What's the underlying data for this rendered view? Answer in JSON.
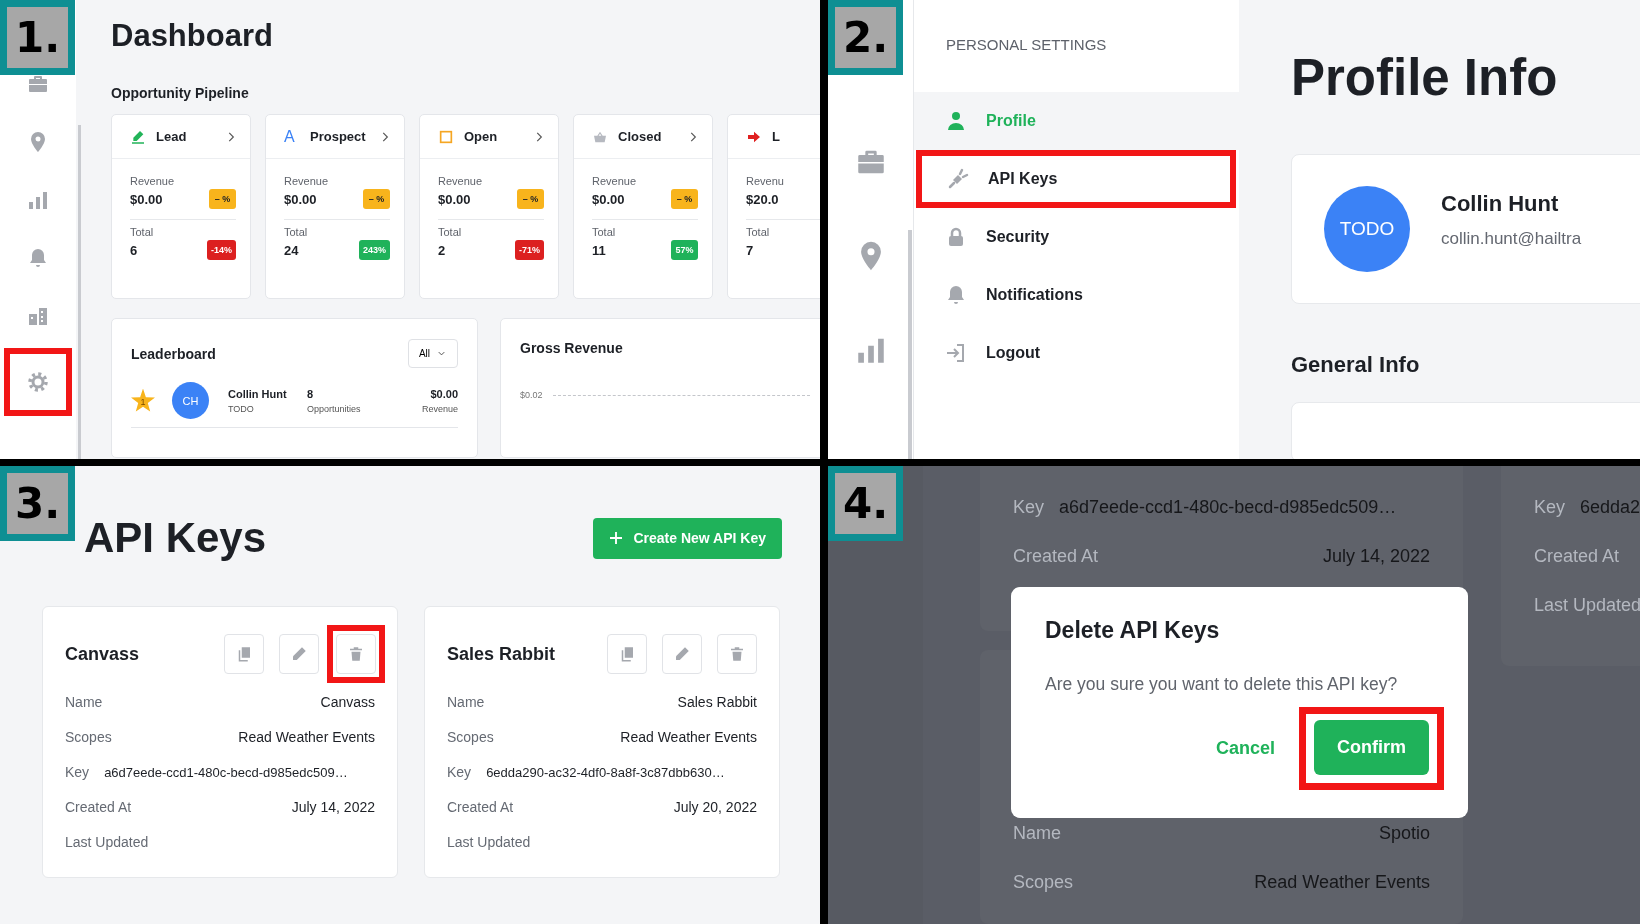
{
  "panels": [
    {
      "kind": "dashboard",
      "step": "1.",
      "nav": [
        {
          "highlighted": false
        },
        {
          "highlighted": false
        },
        {
          "highlighted": false
        },
        {
          "highlighted": false
        },
        {
          "highlighted": false
        },
        {
          "highlighted": true
        }
      ],
      "title": "Dashboard",
      "section": "Opportunity Pipeline",
      "stages": [
        {
          "kind": "pen",
          "label": "Lead",
          "chevron": true,
          "metrics": [
            {
              "label": "Revenue",
              "value": "$0.00",
              "change": "– %",
              "color": "#f8b41c"
            },
            {
              "label": "Total",
              "value": "6",
              "change": "-14%",
              "color": "#dc2020"
            }
          ]
        },
        {
          "kind": "letter",
          "icon_text": "A",
          "label": "Prospect",
          "chevron": true,
          "metrics": [
            {
              "label": "Revenue",
              "value": "$0.00",
              "change": "– %",
              "color": "#f8b41c"
            },
            {
              "label": "Total",
              "value": "24",
              "change": "243%",
              "color": "#1fb25a"
            }
          ]
        },
        {
          "kind": "square",
          "label": "Open",
          "chevron": true,
          "metrics": [
            {
              "label": "Revenue",
              "value": "$0.00",
              "change": "– %",
              "color": "#f8b41c"
            },
            {
              "label": "Total",
              "value": "2",
              "change": "-71%",
              "color": "#dc2020"
            }
          ]
        },
        {
          "kind": "basket",
          "label": "Closed",
          "chevron": true,
          "metrics": [
            {
              "label": "Revenue",
              "value": "$0.00",
              "change": "– %",
              "color": "#f8b41c"
            },
            {
              "label": "Total",
              "value": "11",
              "change": "57%",
              "color": "#1fb25a"
            }
          ]
        },
        {
          "kind": "arrow",
          "label": "L",
          "chevron": false,
          "metrics": [
            {
              "label": "Revenu",
              "value": "$20.0"
            },
            {
              "label": "Total",
              "value": "7"
            }
          ]
        }
      ],
      "leaderboard": {
        "title": "Leaderboard",
        "filter": "All",
        "rows": [
          {
            "rank": "1",
            "initials": "CH",
            "name": "Collin Hunt",
            "subtitle": "TODO",
            "count": "8",
            "count_label": "Opportunities",
            "amount": "$0.00",
            "amount_label": "Revenue"
          }
        ]
      },
      "revenue_chart": {
        "title": "Gross Revenue",
        "axis_label": "$0.02"
      }
    },
    {
      "kind": "settings",
      "step": "2.",
      "heading": "PERSONAL SETTINGS",
      "items": [
        {
          "kind": "person",
          "label": "Profile",
          "selected": true,
          "highlighted": false
        },
        {
          "kind": "plug",
          "label": "API Keys",
          "selected": false,
          "highlighted": true
        },
        {
          "kind": "lock",
          "label": "Security",
          "selected": false,
          "highlighted": false
        },
        {
          "kind": "bell",
          "label": "Notifications",
          "selected": false,
          "highlighted": false
        },
        {
          "kind": "logout",
          "label": "Logout",
          "selected": false,
          "highlighted": false
        }
      ],
      "title": "Profile Info",
      "profile": {
        "avatar": "TODO",
        "name": "Collin Hunt",
        "email": "collin.hunt@hailtra"
      },
      "section": "General Info"
    },
    {
      "kind": "keys",
      "step": "3.",
      "title": "API Keys",
      "create_button": "Create New API Key",
      "keys": [
        {
          "title": "Canvass",
          "delete_highlighted": true,
          "fields": [
            {
              "kind": "pair",
              "label": "Name",
              "value": "Canvass"
            },
            {
              "kind": "pair",
              "label": "Scopes",
              "value": "Read Weather Events"
            },
            {
              "kind": "inline",
              "label": "Key",
              "value": "a6d7eede-ccd1-480c-becd-d985edc509…"
            },
            {
              "kind": "pair",
              "label": "Created At",
              "value": "July 14, 2022"
            },
            {
              "kind": "pair",
              "label": "Last Updated"
            }
          ]
        },
        {
          "title": "Sales Rabbit",
          "delete_highlighted": false,
          "fields": [
            {
              "kind": "pair",
              "label": "Name",
              "value": "Sales Rabbit"
            },
            {
              "kind": "pair",
              "label": "Scopes",
              "value": "Read Weather Events"
            },
            {
              "kind": "inline",
              "label": "Key",
              "value": "6edda290-ac32-4df0-8a8f-3c87dbb630…"
            },
            {
              "kind": "pair",
              "label": "Created At",
              "value": "July 20, 2022"
            },
            {
              "kind": "pair",
              "label": "Last Updated"
            }
          ]
        }
      ]
    },
    {
      "kind": "dialog",
      "step": "4.",
      "background": {
        "left_top": [
          {
            "kind": "inline",
            "label": "Key",
            "value": "a6d7eede-ccd1-480c-becd-d985edc509…"
          },
          {
            "kind": "pair",
            "label": "Created At",
            "value": "July 14, 2022"
          }
        ],
        "left_bottom": [
          {
            "kind": "pair",
            "label": "Name",
            "value": "Spotio"
          },
          {
            "kind": "pair",
            "label": "Scopes",
            "value": "Read Weather Events"
          }
        ],
        "right_top": [
          {
            "kind": "inline",
            "label": "Key",
            "value": "6edda2"
          },
          {
            "kind": "pair",
            "label": "Created At"
          },
          {
            "kind": "pair",
            "label": "Last Updated"
          }
        ]
      },
      "dialog": {
        "title": "Delete API Keys",
        "message": "Are you sure you want to delete this API key?",
        "cancel": "Cancel",
        "confirm": "Confirm",
        "confirm_highlighted": true
      }
    }
  ]
}
